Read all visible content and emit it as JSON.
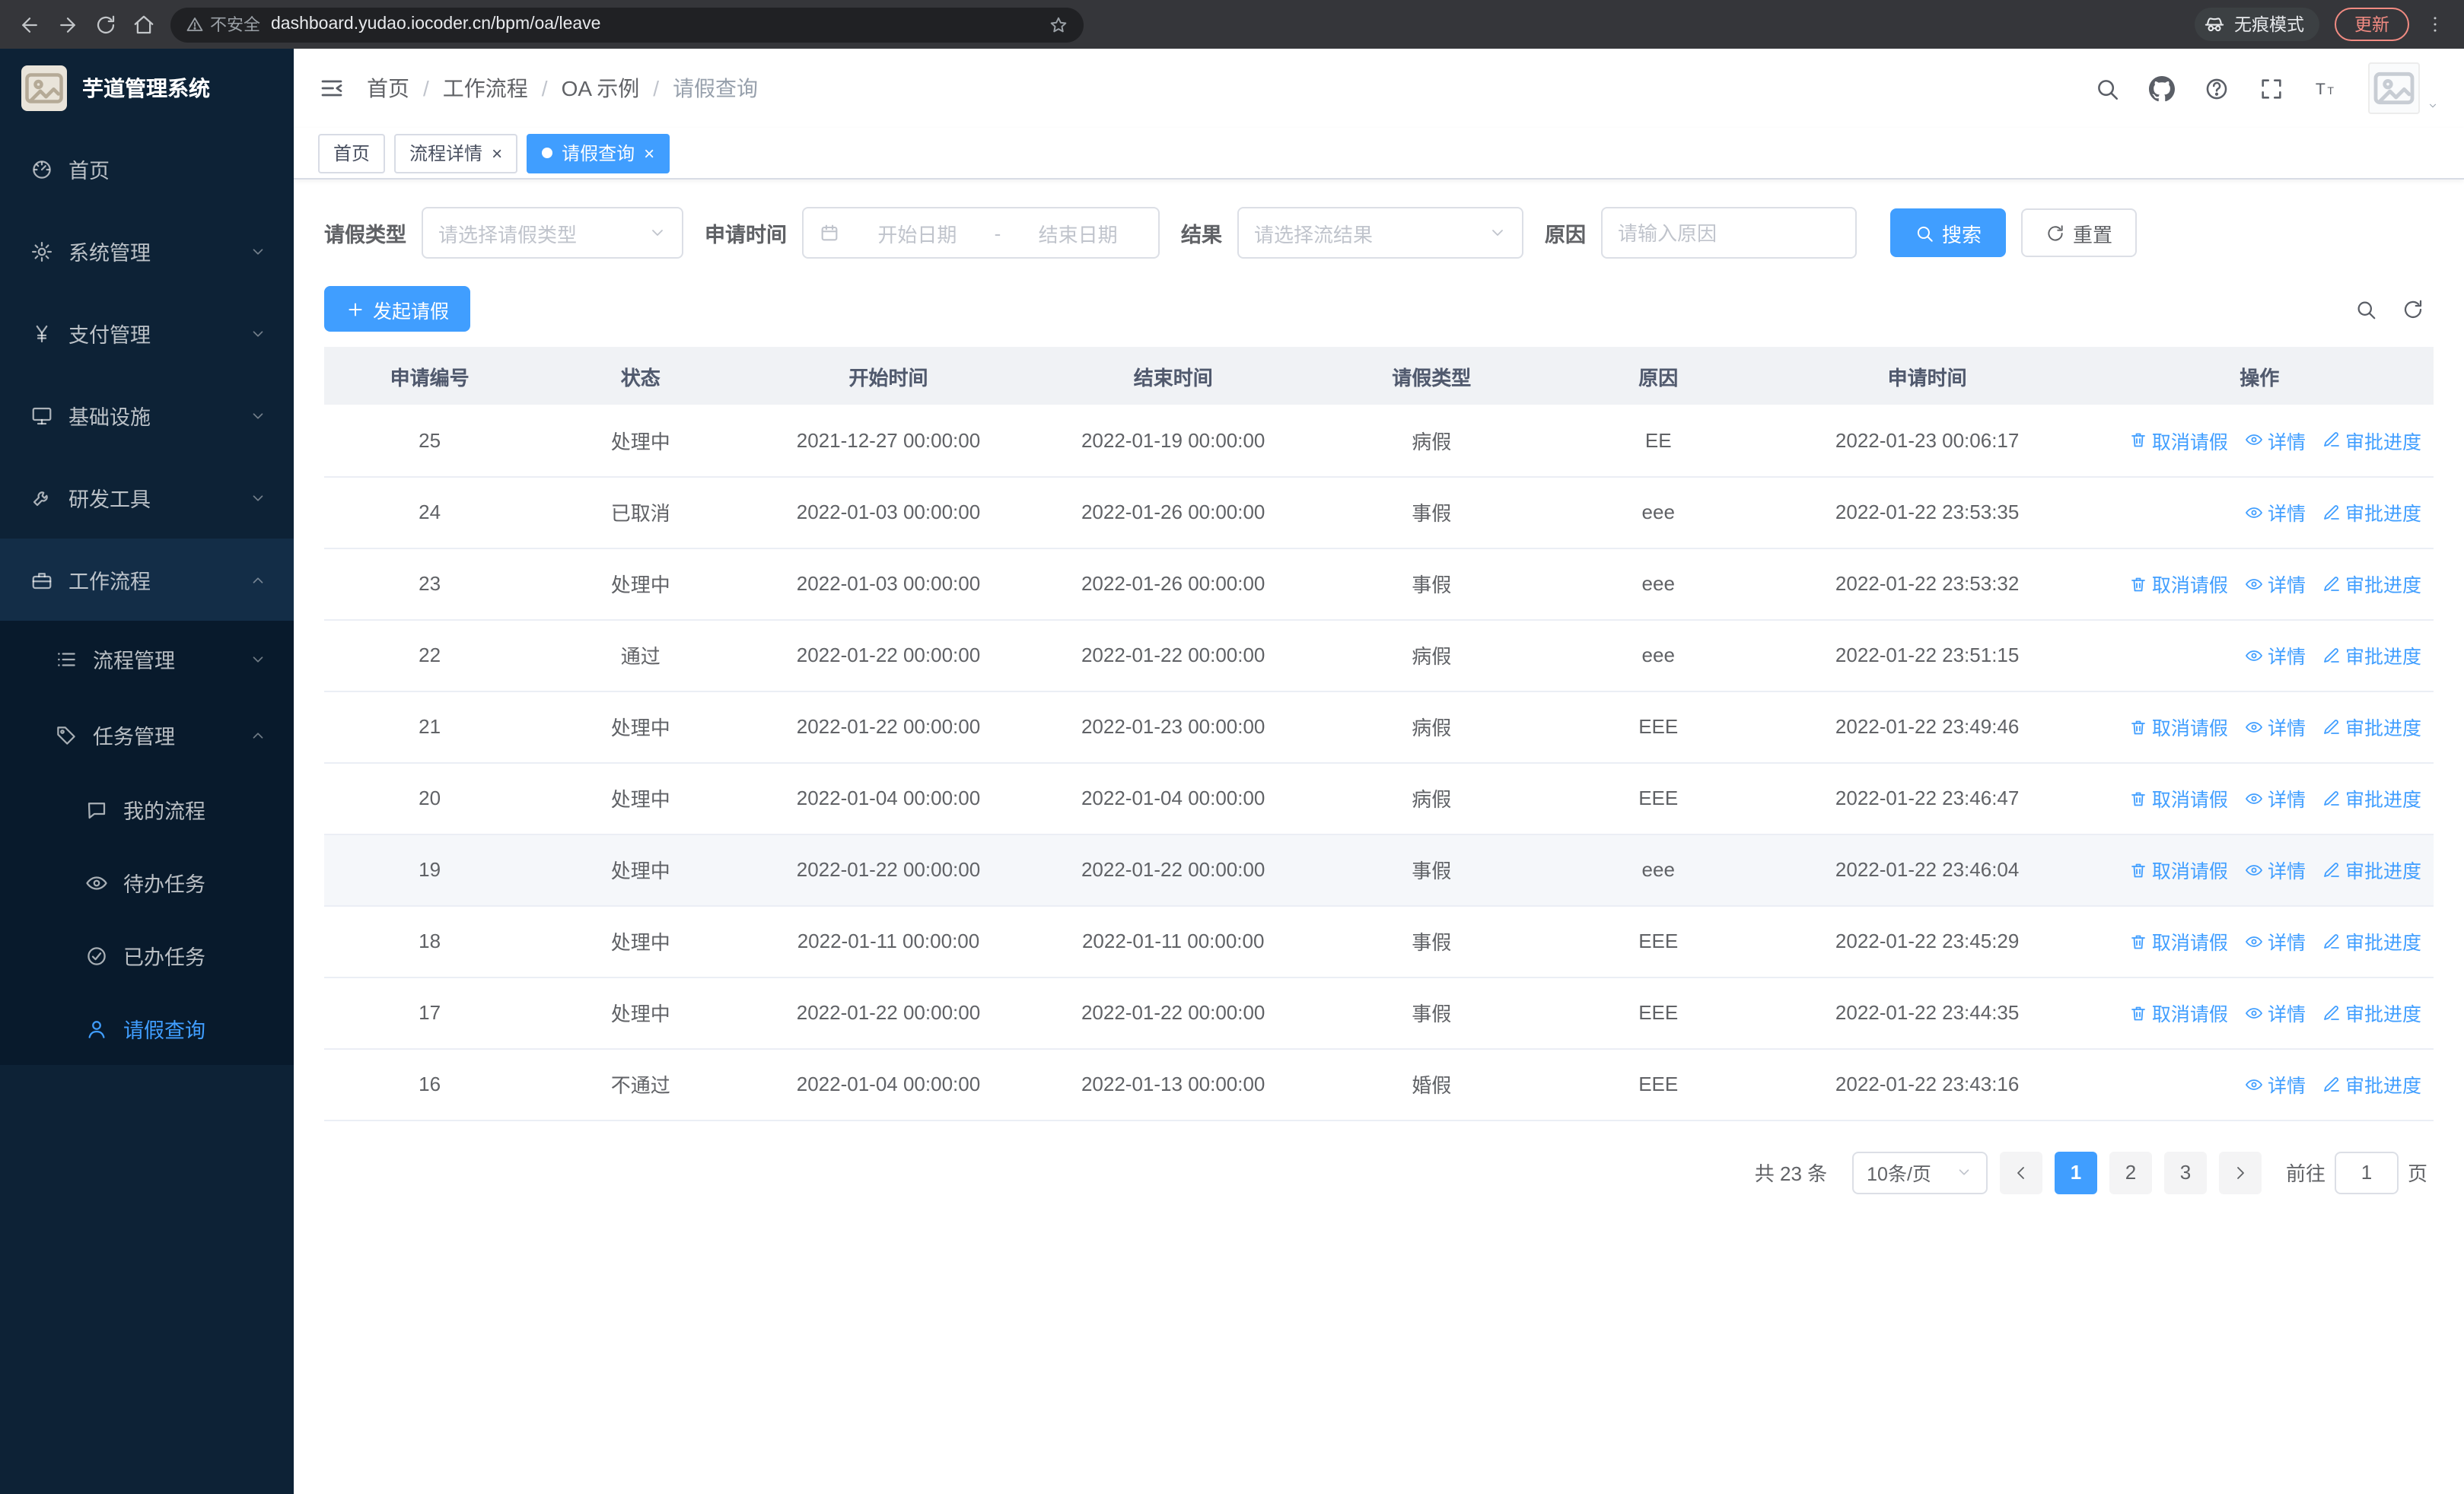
{
  "browser": {
    "security_label": "不安全",
    "url": "dashboard.yudao.iocoder.cn/bpm/oa/leave",
    "incognito_label": "无痕模式",
    "update_label": "更新"
  },
  "sidebar": {
    "app_title": "芋道管理系统",
    "items": [
      {
        "label": "首页",
        "icon": "dashboard",
        "level": 1,
        "arrow": null,
        "active": false,
        "open": false
      },
      {
        "label": "系统管理",
        "icon": "gear",
        "level": 1,
        "arrow": "down",
        "active": false,
        "open": false
      },
      {
        "label": "支付管理",
        "icon": "yen",
        "level": 1,
        "arrow": "down",
        "active": false,
        "open": false
      },
      {
        "label": "基础设施",
        "icon": "platform",
        "level": 1,
        "arrow": "down",
        "active": false,
        "open": false
      },
      {
        "label": "研发工具",
        "icon": "tools",
        "level": 1,
        "arrow": "down",
        "active": false,
        "open": false
      },
      {
        "label": "工作流程",
        "icon": "briefcase",
        "level": 1,
        "arrow": "up",
        "active": false,
        "open": true
      },
      {
        "label": "流程管理",
        "icon": "list",
        "level": 2,
        "arrow": "down",
        "active": false,
        "open": false
      },
      {
        "label": "任务管理",
        "icon": "tag",
        "level": 2,
        "arrow": "up",
        "active": false,
        "open": true
      },
      {
        "label": "我的流程",
        "icon": "chat",
        "level": 3,
        "arrow": null,
        "active": false,
        "open": false
      },
      {
        "label": "待办任务",
        "icon": "eye",
        "level": 3,
        "arrow": null,
        "active": false,
        "open": false
      },
      {
        "label": "已办任务",
        "icon": "check",
        "level": 3,
        "arrow": null,
        "active": false,
        "open": false
      },
      {
        "label": "请假查询",
        "icon": "user",
        "level": 3,
        "arrow": null,
        "active": true,
        "open": false
      }
    ]
  },
  "header": {
    "breadcrumb": [
      "首页",
      "工作流程",
      "OA 示例",
      "请假查询"
    ]
  },
  "tabs": [
    {
      "label": "首页",
      "closable": false,
      "active": false
    },
    {
      "label": "流程详情",
      "closable": true,
      "active": false
    },
    {
      "label": "请假查询",
      "closable": true,
      "active": true
    }
  ],
  "filters": {
    "leave_type_label": "请假类型",
    "leave_type_placeholder": "请选择请假类型",
    "apply_time_label": "申请时间",
    "start_date_placeholder": "开始日期",
    "date_separator": "-",
    "end_date_placeholder": "结束日期",
    "result_label": "结果",
    "result_placeholder": "请选择流结果",
    "reason_label": "原因",
    "reason_placeholder": "请输入原因",
    "search_label": "搜索",
    "reset_label": "重置"
  },
  "toolbar": {
    "create_label": "发起请假"
  },
  "table": {
    "columns": [
      "申请编号",
      "状态",
      "开始时间",
      "结束时间",
      "请假类型",
      "原因",
      "申请时间",
      "操作"
    ],
    "actions": {
      "cancel": "取消请假",
      "detail": "详情",
      "progress": "审批进度"
    },
    "rows": [
      {
        "id": "25",
        "status": "处理中",
        "start": "2021-12-27 00:00:00",
        "end": "2022-01-19 00:00:00",
        "type": "病假",
        "reason": "EE",
        "applied": "2022-01-23 00:06:17",
        "actions": [
          "cancel",
          "detail",
          "progress"
        ],
        "highlight": false
      },
      {
        "id": "24",
        "status": "已取消",
        "start": "2022-01-03 00:00:00",
        "end": "2022-01-26 00:00:00",
        "type": "事假",
        "reason": "eee",
        "applied": "2022-01-22 23:53:35",
        "actions": [
          "detail",
          "progress"
        ],
        "highlight": false
      },
      {
        "id": "23",
        "status": "处理中",
        "start": "2022-01-03 00:00:00",
        "end": "2022-01-26 00:00:00",
        "type": "事假",
        "reason": "eee",
        "applied": "2022-01-22 23:53:32",
        "actions": [
          "cancel",
          "detail",
          "progress"
        ],
        "highlight": false
      },
      {
        "id": "22",
        "status": "通过",
        "start": "2022-01-22 00:00:00",
        "end": "2022-01-22 00:00:00",
        "type": "病假",
        "reason": "eee",
        "applied": "2022-01-22 23:51:15",
        "actions": [
          "detail",
          "progress"
        ],
        "highlight": false
      },
      {
        "id": "21",
        "status": "处理中",
        "start": "2022-01-22 00:00:00",
        "end": "2022-01-23 00:00:00",
        "type": "病假",
        "reason": "EEE",
        "applied": "2022-01-22 23:49:46",
        "actions": [
          "cancel",
          "detail",
          "progress"
        ],
        "highlight": false
      },
      {
        "id": "20",
        "status": "处理中",
        "start": "2022-01-04 00:00:00",
        "end": "2022-01-04 00:00:00",
        "type": "病假",
        "reason": "EEE",
        "applied": "2022-01-22 23:46:47",
        "actions": [
          "cancel",
          "detail",
          "progress"
        ],
        "highlight": false
      },
      {
        "id": "19",
        "status": "处理中",
        "start": "2022-01-22 00:00:00",
        "end": "2022-01-22 00:00:00",
        "type": "事假",
        "reason": "eee",
        "applied": "2022-01-22 23:46:04",
        "actions": [
          "cancel",
          "detail",
          "progress"
        ],
        "highlight": true
      },
      {
        "id": "18",
        "status": "处理中",
        "start": "2022-01-11 00:00:00",
        "end": "2022-01-11 00:00:00",
        "type": "事假",
        "reason": "EEE",
        "applied": "2022-01-22 23:45:29",
        "actions": [
          "cancel",
          "detail",
          "progress"
        ],
        "highlight": false
      },
      {
        "id": "17",
        "status": "处理中",
        "start": "2022-01-22 00:00:00",
        "end": "2022-01-22 00:00:00",
        "type": "事假",
        "reason": "EEE",
        "applied": "2022-01-22 23:44:35",
        "actions": [
          "cancel",
          "detail",
          "progress"
        ],
        "highlight": false
      },
      {
        "id": "16",
        "status": "不通过",
        "start": "2022-01-04 00:00:00",
        "end": "2022-01-13 00:00:00",
        "type": "婚假",
        "reason": "EEE",
        "applied": "2022-01-22 23:43:16",
        "actions": [
          "detail",
          "progress"
        ],
        "highlight": false
      }
    ]
  },
  "pagination": {
    "total_label": "共 23 条",
    "page_size": "10条/页",
    "pages": [
      "1",
      "2",
      "3"
    ],
    "active_page": "1",
    "goto_label": "前往",
    "goto_value": "1",
    "page_suffix_label": "页"
  },
  "colors": {
    "accent": "#409eff",
    "sidebar_bg": "#0d2236",
    "submenu_bg": "#081a2c",
    "update_red": "#f28b82"
  }
}
